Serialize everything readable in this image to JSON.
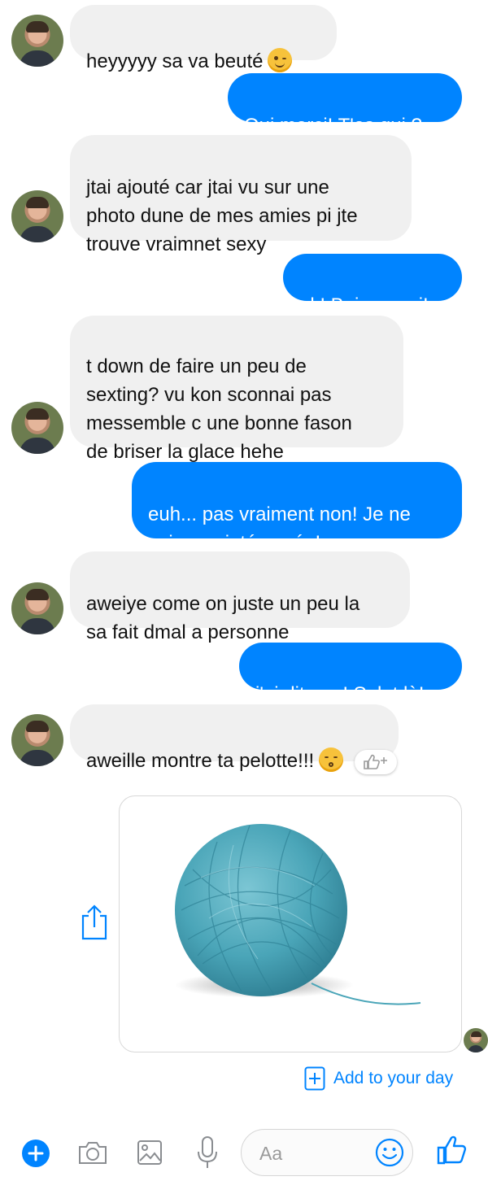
{
  "messages": [
    {
      "side": "in",
      "text": "heyyyyy sa va beuté",
      "emoji": "winking-face-emoji"
    },
    {
      "side": "out",
      "text": "Oui merci! T'es qui ?"
    },
    {
      "side": "in",
      "text": "jtai ajouté car jtai vu sur une\nphoto dune de mes amies pi jte\ntrouve vraimnet sexy"
    },
    {
      "side": "out",
      "text": "ok! Bein merci!"
    },
    {
      "side": "in",
      "text": "t down de faire un peu de\nsexting? vu kon sconnai pas\nmessemble c une bonne fason\nde briser la glace hehe"
    },
    {
      "side": "out",
      "text": "euh... pas vraiment non! Je ne\nsuis pas intéressée!"
    },
    {
      "side": "in",
      "text": "aweiye come on juste un peu la\nsa fait dmal a personne"
    },
    {
      "side": "out",
      "text": "j'ai dit non! Salut là!"
    },
    {
      "side": "in",
      "text": "aweille montre ta pelotte!!!",
      "emoji": "kissing-face-emoji"
    }
  ],
  "photo": {
    "subject": "ball of blue yarn",
    "color": "#4aa5b8"
  },
  "story": {
    "add_label": "Add to your day"
  },
  "composer": {
    "placeholder": "Aa"
  },
  "colors": {
    "accent": "#0084ff",
    "incoming_bubble": "#f0f0f0"
  },
  "icons": [
    "plus-circle-icon",
    "camera-icon",
    "gallery-icon",
    "microphone-icon",
    "smiley-icon",
    "thumbs-up-icon",
    "share-icon",
    "add-box-icon"
  ]
}
